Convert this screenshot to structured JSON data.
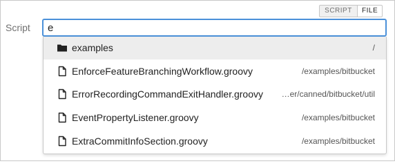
{
  "mode_toggle": {
    "script_label": "SCRIPT",
    "file_label": "FILE"
  },
  "field": {
    "label": "Script",
    "value": "e"
  },
  "suggestions": [
    {
      "name": "examples",
      "path": "/",
      "icon": "folder-icon"
    },
    {
      "name": "EnforceFeatureBranchingWorkflow.groovy",
      "path": "/examples/bitbucket",
      "icon": "file-icon"
    },
    {
      "name": "ErrorRecordingCommandExitHandler.groovy",
      "path": "…er/canned/bitbucket/util",
      "icon": "file-icon"
    },
    {
      "name": "EventPropertyListener.groovy",
      "path": "/examples/bitbucket",
      "icon": "file-icon"
    },
    {
      "name": "ExtraCommitInfoSection.groovy",
      "path": "/examples/bitbucket",
      "icon": "file-icon"
    }
  ],
  "colors": {
    "focus_border": "#4a90d9",
    "highlight_row": "#ededed"
  }
}
